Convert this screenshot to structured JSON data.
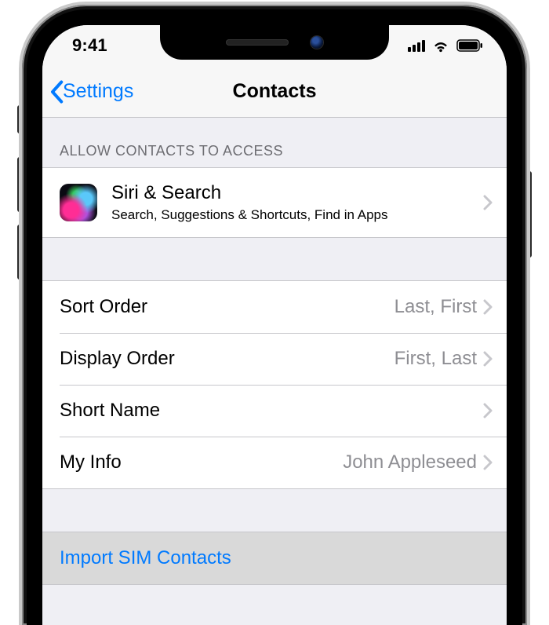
{
  "status": {
    "time": "9:41"
  },
  "nav": {
    "back_label": "Settings",
    "title": "Contacts"
  },
  "section1": {
    "header": "Allow Contacts to Access",
    "siri_title": "Siri & Search",
    "siri_subtitle": "Search, Suggestions & Shortcuts, Find in Apps"
  },
  "section2": {
    "rows": {
      "sort_order": {
        "label": "Sort Order",
        "value": "Last, First"
      },
      "display_order": {
        "label": "Display Order",
        "value": "First, Last"
      },
      "short_name": {
        "label": "Short Name",
        "value": ""
      },
      "my_info": {
        "label": "My Info",
        "value": "John Appleseed"
      }
    }
  },
  "section3": {
    "import_label": "Import SIM Contacts"
  }
}
